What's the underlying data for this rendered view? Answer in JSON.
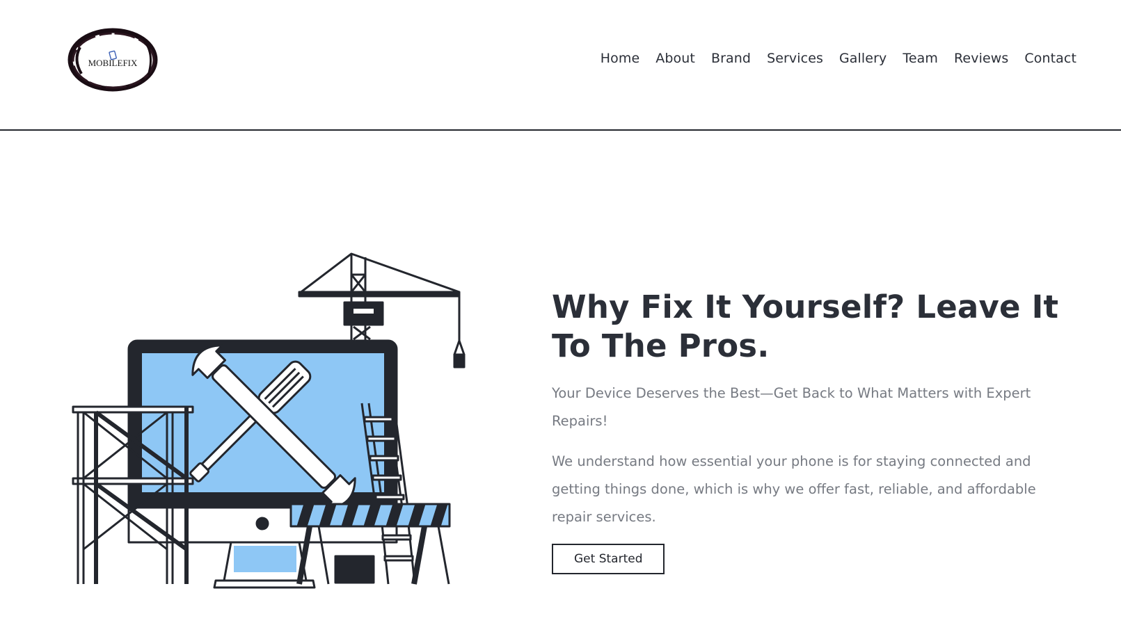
{
  "header": {
    "logo_text": "MOBILEFIX",
    "nav": [
      {
        "label": "Home"
      },
      {
        "label": "About"
      },
      {
        "label": "Brand"
      },
      {
        "label": "Services"
      },
      {
        "label": "Gallery"
      },
      {
        "label": "Team"
      },
      {
        "label": "Reviews"
      },
      {
        "label": "Contact"
      }
    ]
  },
  "hero": {
    "title": "Why Fix It Yourself? Leave It To The Pros.",
    "subtitle": "Your Device Deserves the Best—Get Back to What Matters with Expert Repairs!",
    "description": "We understand how essential your phone is for staying connected and getting things done, which is why we offer fast, reliable, and affordable repair services.",
    "cta_label": "Get Started",
    "illustration": "computer-repair-construction-illustration"
  },
  "colors": {
    "text_dark": "#2b2f38",
    "text_muted": "#767a82",
    "accent_blue": "#8ec7f5",
    "line_dark": "#23262d"
  }
}
